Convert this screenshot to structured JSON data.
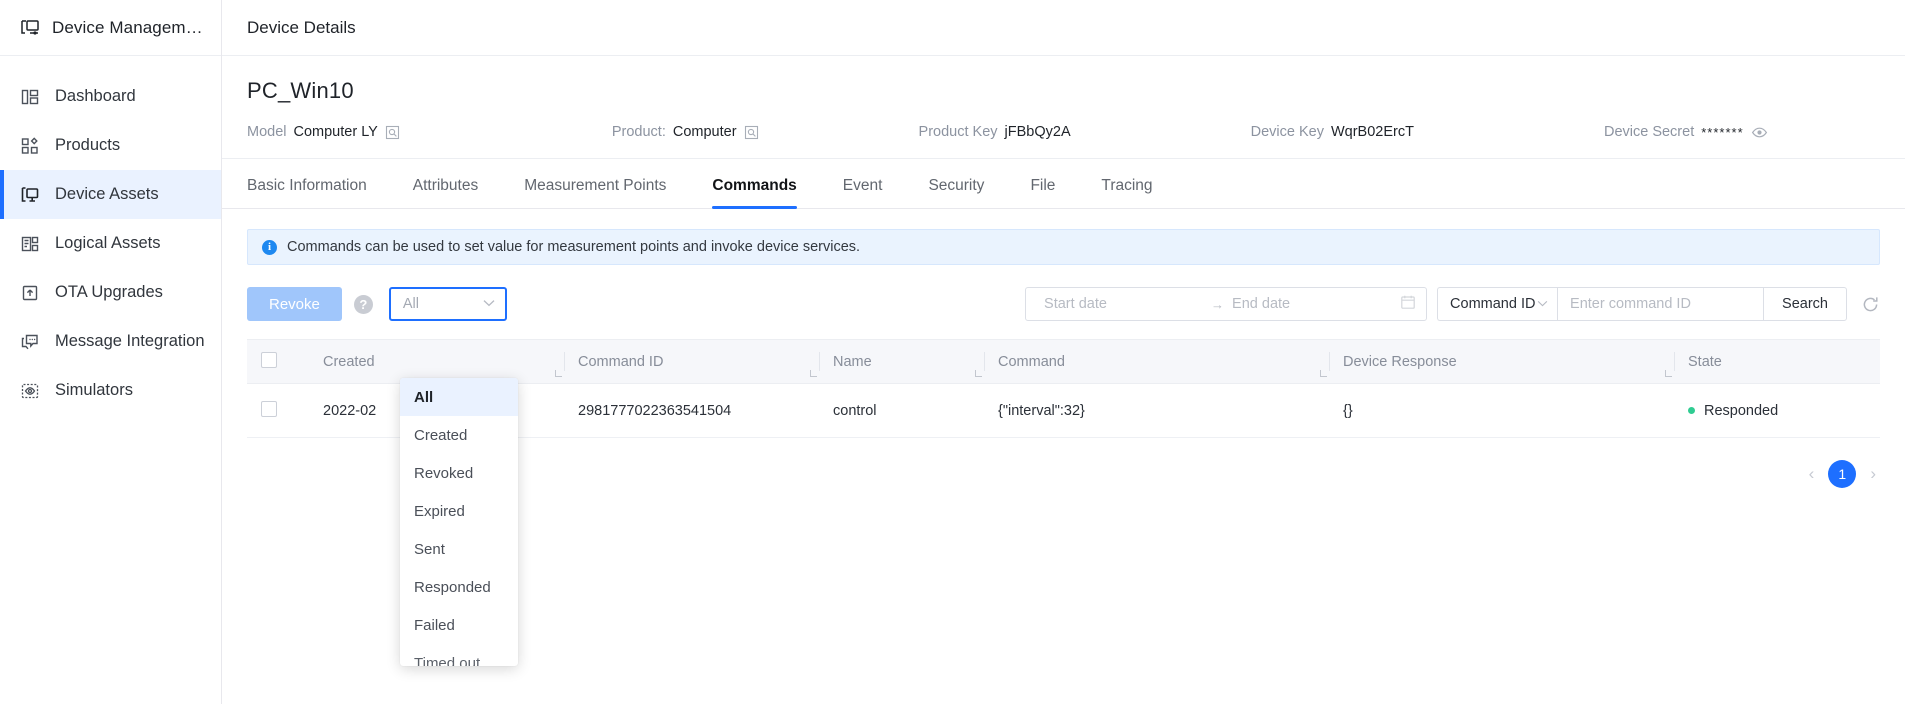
{
  "sidebar": {
    "brand": {
      "title": "Device Managem…",
      "icon": "device-management-icon"
    },
    "items": [
      {
        "label": "Dashboard",
        "icon": "dashboard-icon",
        "active": false
      },
      {
        "label": "Products",
        "icon": "products-icon",
        "active": false
      },
      {
        "label": "Device Assets",
        "icon": "device-assets-icon",
        "active": true
      },
      {
        "label": "Logical Assets",
        "icon": "logical-assets-icon",
        "active": false
      },
      {
        "label": "OTA Upgrades",
        "icon": "ota-upgrades-icon",
        "active": false
      },
      {
        "label": "Message Integration",
        "icon": "message-integration-icon",
        "active": false
      },
      {
        "label": "Simulators",
        "icon": "simulators-icon",
        "active": false
      }
    ]
  },
  "topbar": {
    "title": "Device Details"
  },
  "device": {
    "name": "PC_Win10",
    "model_label": "Model",
    "model_value": "Computer LY",
    "product_label": "Product:",
    "product_value": "Computer",
    "product_key_label": "Product Key",
    "product_key_value": "jFBbQy2A",
    "device_key_label": "Device Key",
    "device_key_value": "WqrB02ErcT",
    "device_secret_label": "Device Secret",
    "device_secret_value": "*******",
    "search_icon": "magnifier-box-icon",
    "eye_icon": "eye-icon"
  },
  "tabs": [
    {
      "label": "Basic Information",
      "active": false
    },
    {
      "label": "Attributes",
      "active": false
    },
    {
      "label": "Measurement Points",
      "active": false
    },
    {
      "label": "Commands",
      "active": true
    },
    {
      "label": "Event",
      "active": false
    },
    {
      "label": "Security",
      "active": false
    },
    {
      "label": "File",
      "active": false
    },
    {
      "label": "Tracing",
      "active": false
    }
  ],
  "alert": {
    "icon": "info-icon",
    "text": "Commands can be used to set value for measurement points and invoke device services."
  },
  "toolbar": {
    "revoke_label": "Revoke",
    "help_label": "?",
    "state_filter_value": "All",
    "caret_icon": "chevron-down-icon"
  },
  "filters": {
    "start_date_placeholder": "Start date",
    "range_arrow": "→",
    "end_date_placeholder": "End date",
    "calendar_icon": "calendar-icon",
    "search_field_label": "Command ID",
    "command_input_placeholder": "Enter command ID",
    "command_input_value": "",
    "search_label": "Search",
    "refresh_icon": "refresh-icon"
  },
  "dropdown": {
    "open": true,
    "options": [
      {
        "label": "All",
        "selected": true
      },
      {
        "label": "Created",
        "selected": false
      },
      {
        "label": "Revoked",
        "selected": false
      },
      {
        "label": "Expired",
        "selected": false
      },
      {
        "label": "Sent",
        "selected": false
      },
      {
        "label": "Responded",
        "selected": false
      },
      {
        "label": "Failed",
        "selected": false
      },
      {
        "label": "Timed out",
        "selected": false
      }
    ]
  },
  "table": {
    "columns": [
      "Created",
      "Command ID",
      "Name",
      "Command",
      "Device Response",
      "State"
    ],
    "rows": [
      {
        "created": "2022-02",
        "command_id": "2981777022363541504",
        "name": "control",
        "command": "{\"interval\":32}",
        "device_response": "{}",
        "state": "Responded",
        "state_color": "#2fcc92"
      }
    ]
  },
  "pagination": {
    "prev": "‹",
    "current": "1",
    "next": "›"
  },
  "colors": {
    "accent": "#1e6fff",
    "alert_bg": "#eaf3fe",
    "state_ok": "#2fcc92",
    "revoke_btn": "#a0c6fb"
  }
}
